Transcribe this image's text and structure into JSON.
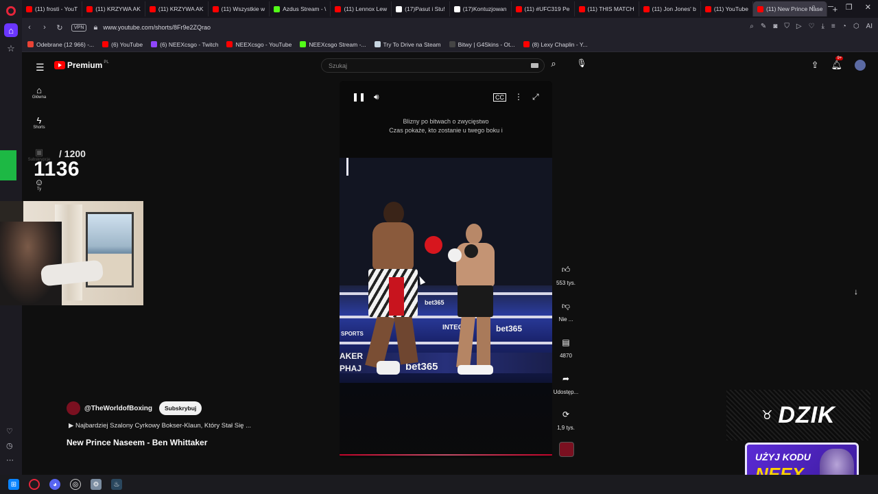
{
  "browser": {
    "tabs": [
      {
        "label": "(11) frosti - YouT",
        "color": "#ff0000"
      },
      {
        "label": "(11) KRZYWA AK",
        "color": "#ff0000"
      },
      {
        "label": "(11) KRZYWA AK",
        "color": "#ff0000"
      },
      {
        "label": "(11) Wszystkie w",
        "color": "#ff0000"
      },
      {
        "label": "Azdus Stream - \\",
        "color": "#53fc18"
      },
      {
        "label": "(11) Lennox Lew",
        "color": "#ff0000"
      },
      {
        "label": "(17)Pasut i Stu!",
        "color": "#ffffff"
      },
      {
        "label": "(17)Kontuzjowan",
        "color": "#ffffff"
      },
      {
        "label": "(11) #UFC319 Pe",
        "color": "#ff0000"
      },
      {
        "label": "(11) THIS MATCH",
        "color": "#ff0000"
      },
      {
        "label": "(11) Jon Jones' b",
        "color": "#ff0000"
      },
      {
        "label": "(11) YouTube",
        "color": "#ff0000"
      },
      {
        "label": "(11) New Prince Nase",
        "color": "#ff0000",
        "active": true
      }
    ],
    "url": "www.youtube.com/shorts/8Fr9e2ZQrao",
    "vpn_label": "VPN",
    "bookmarks": [
      {
        "label": "Odebrane (12 966) -...",
        "color": "#ea4335"
      },
      {
        "label": "(6) YouTube",
        "color": "#ff0000"
      },
      {
        "label": "(6) NEEXcsgo - Twitch",
        "color": "#9146ff"
      },
      {
        "label": "NEEXcsgo - YouTube",
        "color": "#ff0000"
      },
      {
        "label": "NEEXcsgo Stream -...",
        "color": "#53fc18"
      },
      {
        "label": "Try To Drive na Steam",
        "color": "#c7d5e0"
      },
      {
        "label": "Bitwy | G4Skins - Ot...",
        "color": "#444444"
      },
      {
        "label": "(8) Lexy Chaplin - Y...",
        "color": "#ff0000"
      }
    ]
  },
  "youtube": {
    "logo_text": "Premium",
    "logo_country": "PL",
    "search_placeholder": "Szukaj",
    "notification_badge": "9+",
    "guide": [
      {
        "label": "Główna",
        "icon": "home-icon"
      },
      {
        "label": "Shorts",
        "icon": "shorts-icon"
      },
      {
        "label": "Subskrypcje",
        "icon": "subscriptions-icon"
      },
      {
        "label": "Ty",
        "icon": "you-icon"
      }
    ]
  },
  "overlay": {
    "counter_value": "1136",
    "counter_max": "/ 1200"
  },
  "short": {
    "lyrics_line1": "Blizny po bitwach o zwycięstwo",
    "lyrics_line2": "Czas pokaże, kto zostanie u twego boku i",
    "ad_texts": [
      "bet365",
      "bet365",
      "INTEGR",
      "SPORTS",
      "AKER",
      "PHAJ",
      "bet365"
    ],
    "actions": {
      "likes": "553 tys.",
      "dislike": "Nie ...",
      "comments": "4870",
      "share": "Udostęp...",
      "remix": "1,9 tys."
    },
    "channel_name": "@TheWorldofBoxing",
    "subscribe_label": "Subskrybuj",
    "description": "Najbardziej Szalony Cyrkowy Bokser-Klaun, Który Stał Się ...",
    "title": "New Prince Naseem - Ben Whittaker"
  },
  "sponsor": {
    "brand": "DZIK",
    "code_line1": "UŻYJ KODU",
    "code_line2": "NEEX"
  }
}
